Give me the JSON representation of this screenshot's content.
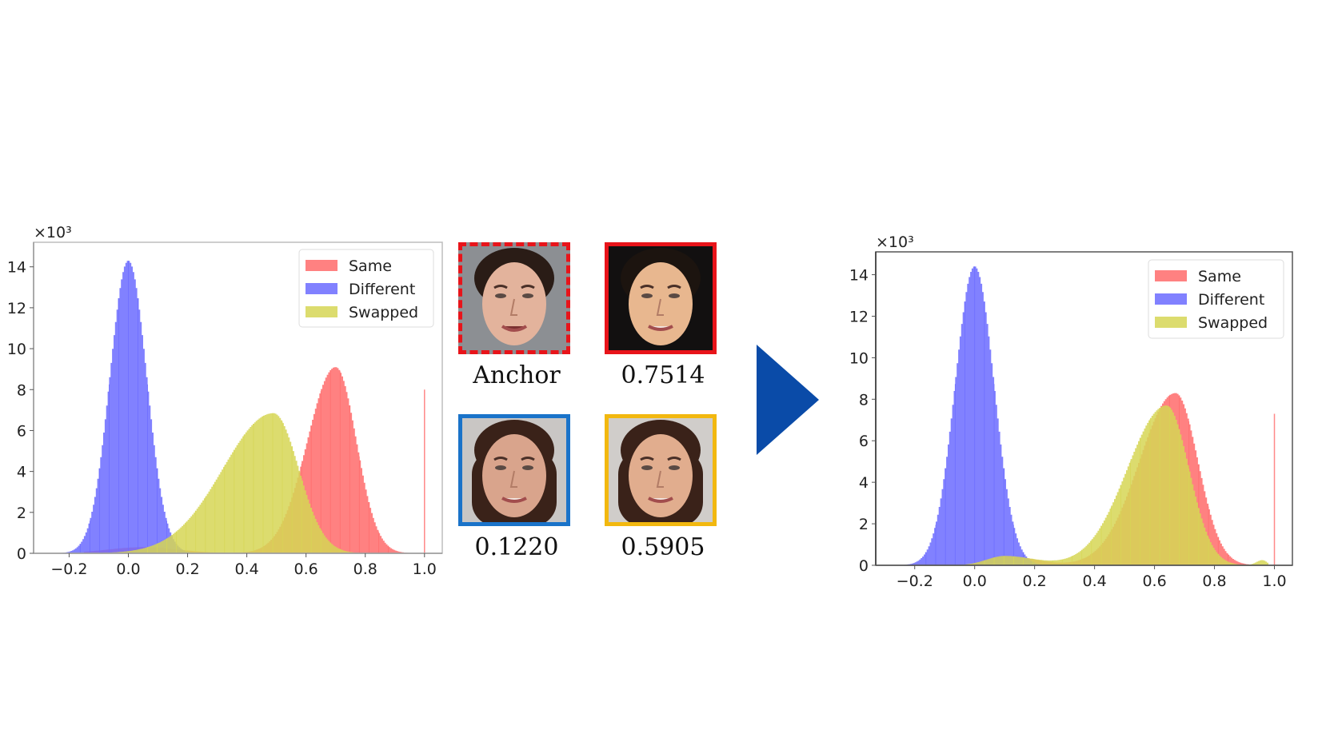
{
  "figure": {
    "arrow_color": "#0a4ba8",
    "faces": [
      {
        "id": "anchor",
        "label": "Anchor",
        "border_color": "#e8141a",
        "border_style": "dashed",
        "skin": "#e3b39c",
        "hair": "#2a1c16",
        "bg": "#8c8f93"
      },
      {
        "id": "same",
        "label": "0.7514",
        "border_color": "#e8141a",
        "border_style": "solid",
        "skin": "#e8b78f",
        "hair": "#1c140f",
        "bg": "#121010"
      },
      {
        "id": "different",
        "label": "0.1220",
        "border_color": "#1a73c9",
        "border_style": "solid",
        "skin": "#d9a48c",
        "hair": "#3a2219",
        "bg": "#c9c6c4"
      },
      {
        "id": "swapped",
        "label": "0.5905",
        "border_color": "#f2b80f",
        "border_style": "solid",
        "skin": "#e1ad8e",
        "hair": "#3a2219",
        "bg": "#d0cdca"
      }
    ]
  },
  "chart_data": [
    {
      "type": "bar",
      "subtype": "overlapping-histogram",
      "title": "",
      "xlabel": "",
      "ylabel": "",
      "y_multiplier_label": "×10³",
      "xlim": [
        -0.32,
        1.06
      ],
      "ylim": [
        0,
        15.2
      ],
      "xticks": [
        -0.2,
        0.0,
        0.2,
        0.4,
        0.6,
        0.8,
        1.0
      ],
      "xtick_labels": [
        "−0.2",
        "0.0",
        "0.2",
        "0.4",
        "0.6",
        "0.8",
        "1.0"
      ],
      "yticks": [
        0,
        2,
        4,
        6,
        8,
        10,
        12,
        14
      ],
      "ytick_labels": [
        "0",
        "2",
        "4",
        "6",
        "8",
        "10",
        "12",
        "14"
      ],
      "grid": false,
      "legend_position": "top-right",
      "series": [
        {
          "name": "Same",
          "color": "#ff6b6b",
          "opacity": 0.85,
          "components": [
            {
              "peak": 9.1,
              "mean": 0.7,
              "sd_left": 0.095,
              "sd_right": 0.07
            },
            {
              "peak": 0.3,
              "mean": 0.05,
              "sd_left": 0.12,
              "sd_right": 0.12
            }
          ],
          "range": [
            -0.15,
            0.98
          ],
          "spike": {
            "x": 1.0,
            "value": 8.0
          }
        },
        {
          "name": "Different",
          "color": "#6b6bff",
          "opacity": 0.85,
          "components": [
            {
              "peak": 14.3,
              "mean": 0.0,
              "sd_left": 0.062,
              "sd_right": 0.062
            }
          ],
          "range": [
            -0.27,
            0.3
          ]
        },
        {
          "name": "Swapped",
          "color": "#d6d655",
          "opacity": 0.85,
          "components": [
            {
              "peak": 6.85,
              "mean": 0.49,
              "sd_left": 0.17,
              "sd_right": 0.085
            }
          ],
          "range": [
            -0.15,
            0.85
          ]
        }
      ]
    },
    {
      "type": "bar",
      "subtype": "overlapping-histogram",
      "title": "",
      "xlabel": "",
      "ylabel": "",
      "y_multiplier_label": "×10³",
      "xlim": [
        -0.33,
        1.06
      ],
      "ylim": [
        0,
        15.1
      ],
      "xticks": [
        -0.2,
        0.0,
        0.2,
        0.4,
        0.6,
        0.8,
        1.0
      ],
      "xtick_labels": [
        "−0.2",
        "0.0",
        "0.2",
        "0.4",
        "0.6",
        "0.8",
        "1.0"
      ],
      "yticks": [
        0,
        2,
        4,
        6,
        8,
        10,
        12,
        14
      ],
      "ytick_labels": [
        "0",
        "2",
        "4",
        "6",
        "8",
        "10",
        "12",
        "14"
      ],
      "grid": false,
      "legend_position": "top-right",
      "series": [
        {
          "name": "Same",
          "color": "#ff6b6b",
          "opacity": 0.85,
          "components": [
            {
              "peak": 8.3,
              "mean": 0.67,
              "sd_left": 0.12,
              "sd_right": 0.075
            },
            {
              "peak": 0.45,
              "mean": 0.1,
              "sd_left": 0.06,
              "sd_right": 0.1
            }
          ],
          "range": [
            -0.1,
            0.97
          ],
          "spike": {
            "x": 1.0,
            "value": 7.3
          }
        },
        {
          "name": "Different",
          "color": "#6b6bff",
          "opacity": 0.85,
          "components": [
            {
              "peak": 14.4,
              "mean": 0.0,
              "sd_left": 0.065,
              "sd_right": 0.065
            }
          ],
          "range": [
            -0.26,
            0.3
          ]
        },
        {
          "name": "Swapped",
          "color": "#d6d655",
          "opacity": 0.85,
          "components": [
            {
              "peak": 7.7,
              "mean": 0.64,
              "sd_left": 0.13,
              "sd_right": 0.075
            },
            {
              "peak": 0.45,
              "mean": 0.1,
              "sd_left": 0.06,
              "sd_right": 0.1
            },
            {
              "peak": 0.25,
              "mean": 0.96,
              "sd_left": 0.02,
              "sd_right": 0.015
            }
          ],
          "range": [
            -0.1,
            0.98
          ]
        }
      ]
    }
  ]
}
